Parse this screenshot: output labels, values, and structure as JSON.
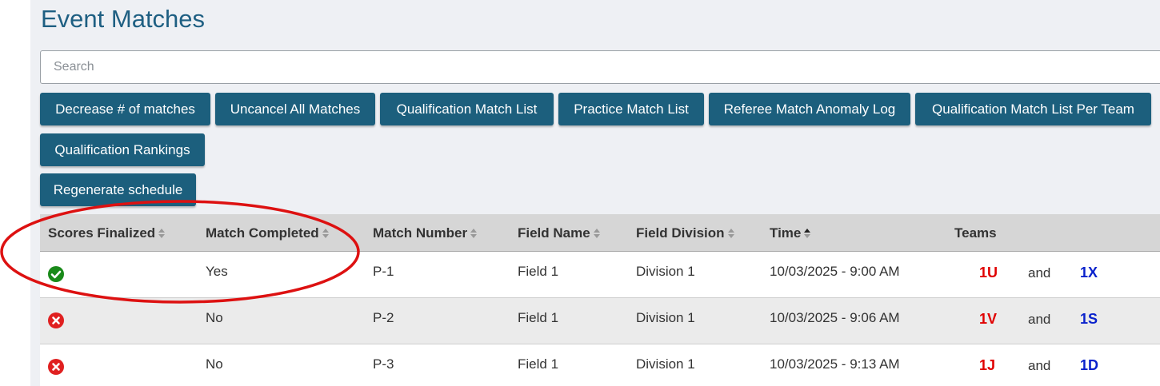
{
  "page": {
    "title": "Event Matches",
    "search_placeholder": "Search"
  },
  "buttons": {
    "decrease": "Decrease # of matches",
    "uncancel": "Uncancel All Matches",
    "qual_list": "Qualification Match List",
    "practice_list": "Practice Match List",
    "anomaly_log": "Referee Match Anomaly Log",
    "qual_list_per_team": "Qualification Match List Per Team",
    "qual_rankings": "Qualification Rankings",
    "regenerate": "Regenerate schedule"
  },
  "table": {
    "headers": {
      "scores_finalized": "Scores Finalized",
      "match_completed": "Match Completed",
      "match_number": "Match Number",
      "field_name": "Field Name",
      "field_division": "Field Division",
      "time": "Time",
      "teams": "Teams"
    },
    "rows": [
      {
        "scores_finalized": "check-circle-icon",
        "match_completed": "Yes",
        "match_number": "P-1",
        "field_name": "Field 1",
        "field_division": "Division 1",
        "time": "10/03/2025 - 9:00 AM",
        "team_red": "1U",
        "and": "and",
        "team_blue": "1X"
      },
      {
        "scores_finalized": "x-circle-icon",
        "match_completed": "No",
        "match_number": "P-2",
        "field_name": "Field 1",
        "field_division": "Division 1",
        "time": "10/03/2025 - 9:06 AM",
        "team_red": "1V",
        "and": "and",
        "team_blue": "1S"
      },
      {
        "scores_finalized": "x-circle-icon",
        "match_completed": "No",
        "match_number": "P-3",
        "field_name": "Field 1",
        "field_division": "Division 1",
        "time": "10/03/2025 - 9:13 AM",
        "team_red": "1J",
        "and": "and",
        "team_blue": "1D"
      }
    ]
  },
  "colors": {
    "title": "#1e5f82",
    "button": "#1c5f7d",
    "success": "#1a8a1a",
    "error": "#e02020",
    "team_red": "#e00000",
    "team_blue": "#0a22cc",
    "annotation": "#dd1111"
  }
}
